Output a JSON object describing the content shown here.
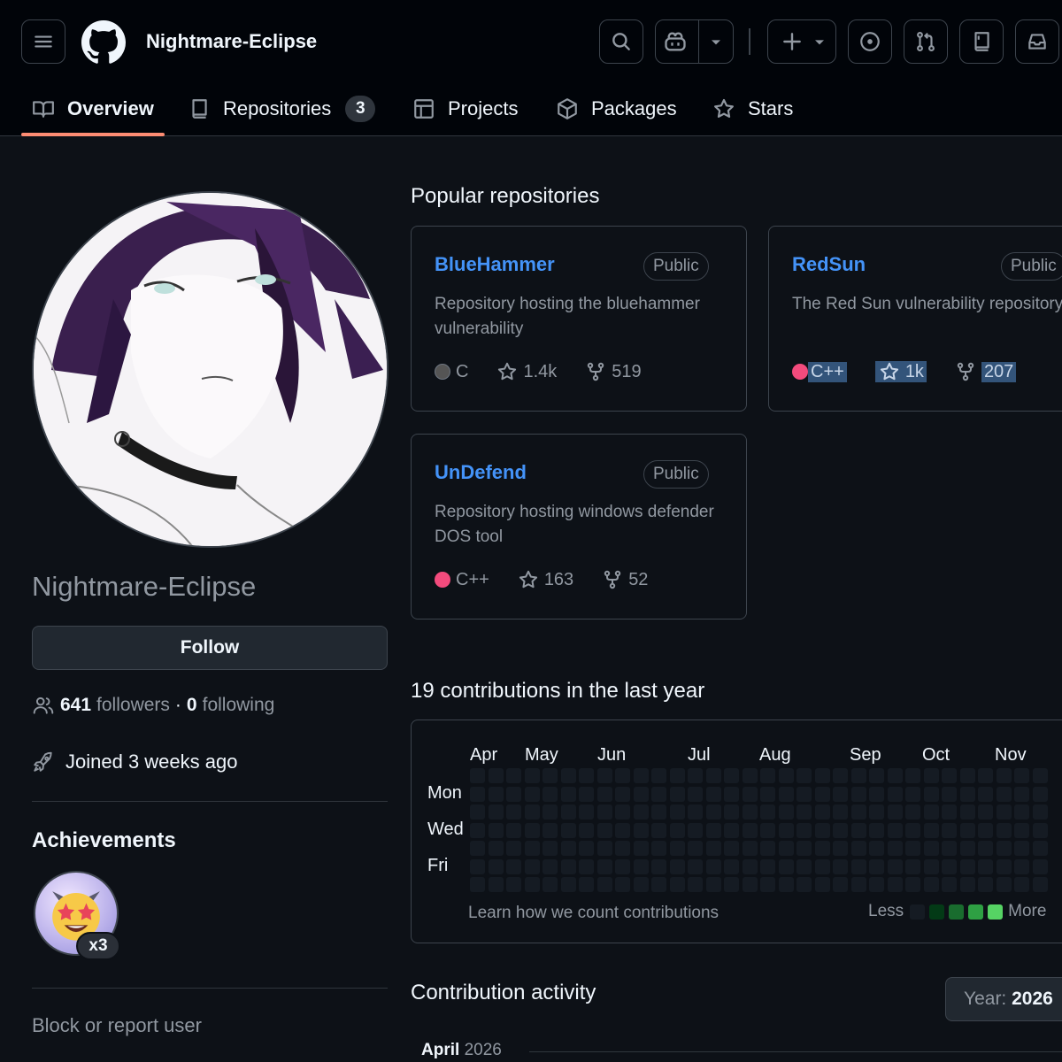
{
  "header": {
    "username": "Nightmare-Eclipse",
    "icons": [
      "menu-icon",
      "github-logo-icon",
      "search-icon",
      "copilot-icon",
      "triangle-down-icon",
      "plus-icon",
      "issue-icon",
      "pull-request-icon",
      "repo-icon",
      "inbox-icon"
    ]
  },
  "tabs": [
    {
      "label": "Overview",
      "icon": "book-icon",
      "active": true
    },
    {
      "label": "Repositories",
      "icon": "repo-icon",
      "count": "3"
    },
    {
      "label": "Projects",
      "icon": "table-icon"
    },
    {
      "label": "Packages",
      "icon": "package-icon"
    },
    {
      "label": "Stars",
      "icon": "star-icon"
    }
  ],
  "profile": {
    "display_name": "Nightmare-Eclipse",
    "follow_label": "Follow",
    "followers_count": "641",
    "followers_label": "followers",
    "following_count": "0",
    "following_label": "following",
    "joined": "Joined 3 weeks ago",
    "achievements_title": "Achievements",
    "achievement_count": "x3",
    "block_label": "Block or report user"
  },
  "popular": {
    "title": "Popular repositories",
    "repos": [
      {
        "name": "BlueHammer",
        "visibility": "Public",
        "description": "Repository hosting the bluehammer vulnerability",
        "language": "C",
        "language_color": "#555555",
        "stars": "1.4k",
        "forks": "519"
      },
      {
        "name": "RedSun",
        "visibility": "Public",
        "description": "The Red Sun vulnerability repository",
        "language": "C++",
        "language_color": "#f34b7d",
        "stars": "1k",
        "forks": "207"
      },
      {
        "name": "UnDefend",
        "visibility": "Public",
        "description": "Repository hosting windows defender DOS tool",
        "language": "C++",
        "language_color": "#f34b7d",
        "stars": "163",
        "forks": "52"
      }
    ]
  },
  "contributions": {
    "title": "19 contributions in the last year",
    "months": [
      "Apr",
      "May",
      "Jun",
      "Jul",
      "Aug",
      "Sep",
      "Oct",
      "Nov"
    ],
    "days": [
      "Mon",
      "Wed",
      "Fri"
    ],
    "learn_label": "Learn how we count contributions",
    "less_label": "Less",
    "more_label": "More",
    "level_colors": [
      "#151b23",
      "#033a16",
      "#196c2e",
      "#2ea043",
      "#56d364"
    ]
  },
  "activity": {
    "title": "Contribution activity",
    "year_label": "Year:",
    "year_value": "2026",
    "month_name": "April",
    "month_year": "2026"
  }
}
